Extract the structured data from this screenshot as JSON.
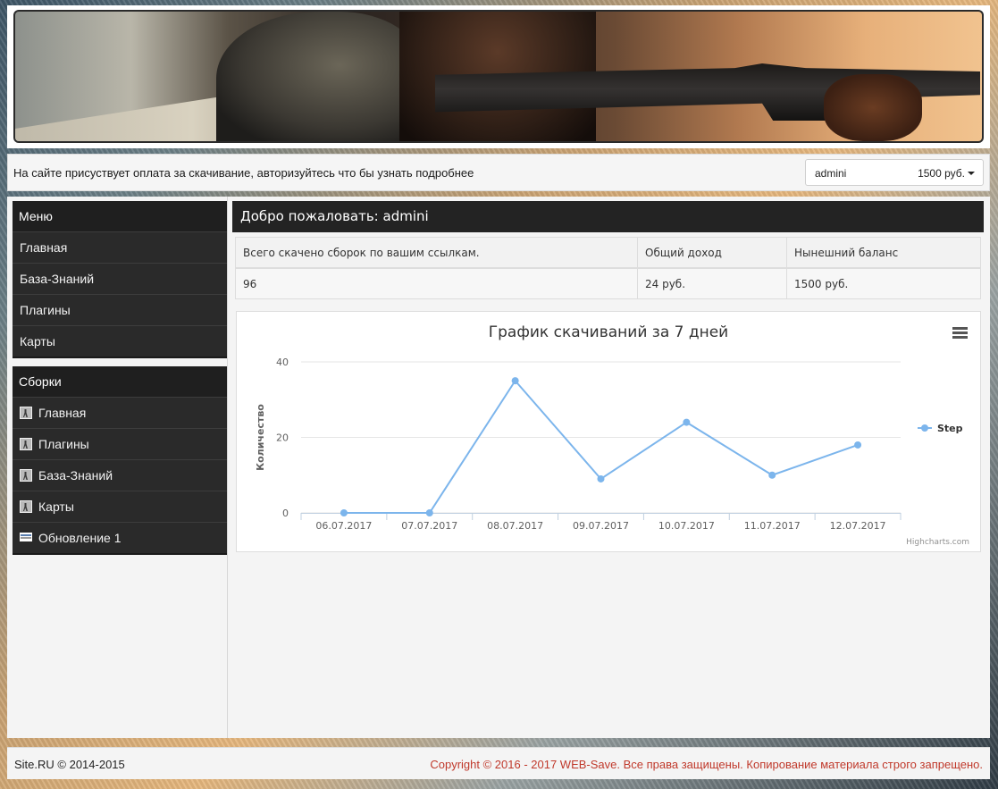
{
  "notice": {
    "text": "На сайте присуствует оплата за скачивание, авторизуйтесь что бы узнать подробнее"
  },
  "account": {
    "username": "admini",
    "balance": "1500 руб."
  },
  "sidebar": {
    "menu": {
      "title": "Меню",
      "items": [
        {
          "label": "Главная"
        },
        {
          "label": "База-Знаний"
        },
        {
          "label": "Плагины"
        },
        {
          "label": "Карты"
        }
      ]
    },
    "builds": {
      "title": "Сборки",
      "items": [
        {
          "label": "Главная",
          "icon": "cs-icon"
        },
        {
          "label": "Плагины",
          "icon": "cs-icon"
        },
        {
          "label": "База-Знаний",
          "icon": "cs-icon"
        },
        {
          "label": "Карты",
          "icon": "cs-icon"
        },
        {
          "label": "Обновление 1",
          "icon": "news-icon"
        }
      ]
    }
  },
  "main": {
    "welcome": "Добро пожаловать: admini",
    "stats": {
      "headers": [
        "Всего скачено сборок по вашим ссылкам.",
        "Общий доход",
        "Нынешний баланс"
      ],
      "row": [
        "96",
        "24 руб.",
        "1500 руб."
      ]
    }
  },
  "chart_data": {
    "type": "line",
    "title": "График скачиваний за 7 дней",
    "ylabel": "Количество",
    "xlabel": "",
    "categories": [
      "06.07.2017",
      "07.07.2017",
      "08.07.2017",
      "09.07.2017",
      "10.07.2017",
      "11.07.2017",
      "12.07.2017"
    ],
    "series": [
      {
        "name": "Step",
        "values": [
          0,
          0,
          35,
          9,
          24,
          10,
          18
        ],
        "color": "#7cb5ec"
      }
    ],
    "ylim": [
      0,
      40
    ],
    "yticks": [
      0,
      20,
      40
    ],
    "grid": true,
    "legend": "right",
    "credits": "Highcharts.com"
  },
  "footer": {
    "left": "Site.RU © 2014-2015",
    "right": "Copyright © 2016 - 2017 WEB-Save. Все права защищены. Копирование материала строго запрещено."
  }
}
